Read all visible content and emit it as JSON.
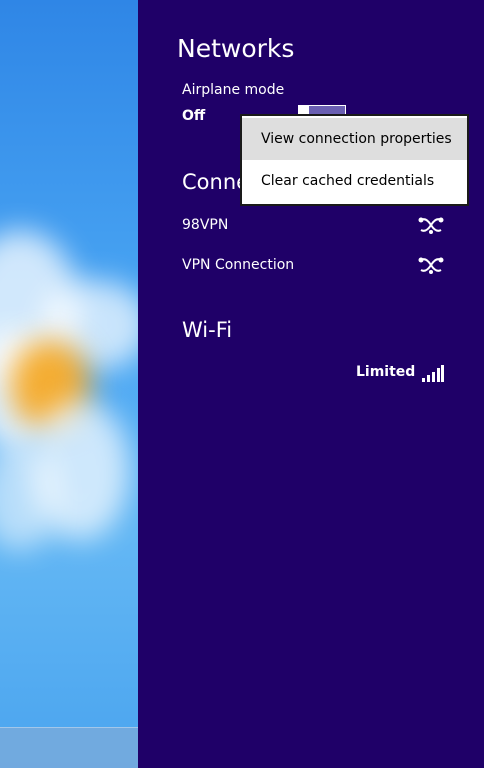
{
  "panel": {
    "title": "Networks",
    "airplane_mode": {
      "label": "Airplane mode",
      "state": "Off"
    },
    "connections_section": {
      "title": "Connections",
      "items": [
        {
          "name": "98VPN",
          "icon": "vpn-icon"
        },
        {
          "name": "VPN Connection",
          "icon": "vpn-icon"
        }
      ]
    },
    "wifi_section": {
      "title": "Wi-Fi",
      "status": "Limited",
      "icon": "wifi-signal-icon"
    }
  },
  "context_menu": {
    "items": [
      {
        "label": "View connection properties",
        "highlighted": true
      },
      {
        "label": "Clear cached credentials",
        "highlighted": false
      }
    ]
  },
  "colors": {
    "panel_bg": "#1f0068",
    "menu_highlight": "#dedede"
  }
}
